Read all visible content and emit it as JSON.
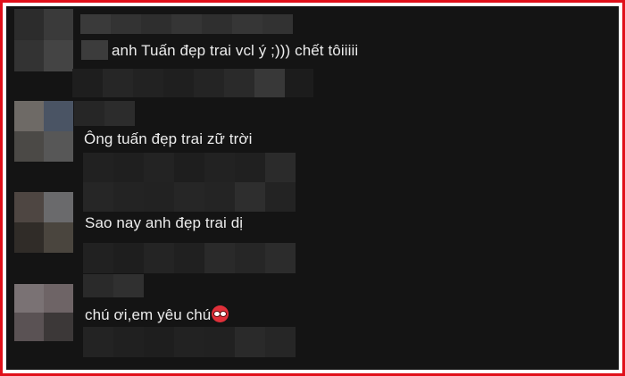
{
  "comments": [
    {
      "text": "anh Tuấn đẹp trai vcl ý ;))) chết tôiiiii"
    },
    {
      "text": "Ông tuấn đẹp trai zữ trời"
    },
    {
      "text": "Sao nay anh đẹp trai dị"
    },
    {
      "text": "chú ơi,em yêu chú",
      "emoji": "angry-face-emoji"
    }
  ],
  "colors": {
    "background": "#141414",
    "border": "#e0101a",
    "text": "#ececec"
  }
}
